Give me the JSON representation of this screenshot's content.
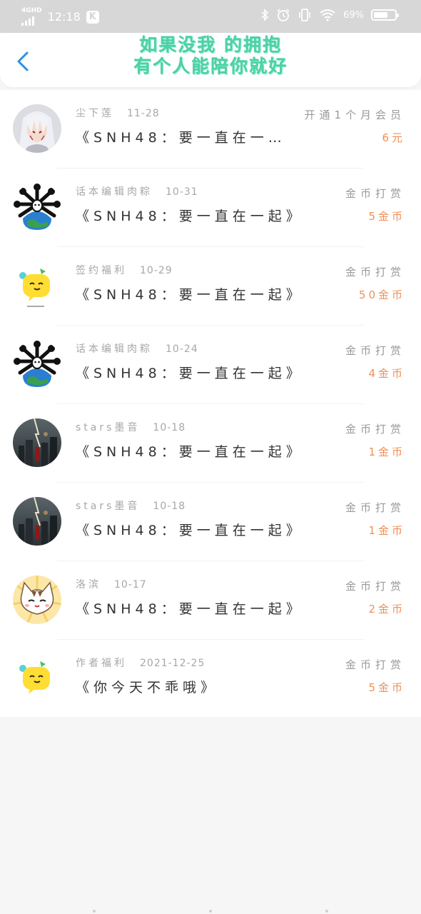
{
  "status_bar": {
    "network": "4GHD",
    "time": "12:18",
    "app_badge": "K",
    "battery": "69%",
    "battery_level": 0.69
  },
  "header": {
    "title_line1": "如果没我 的拥抱",
    "title_line2": "有个人能陪你就好"
  },
  "records": [
    {
      "name": "尘下莲",
      "date": "11-28",
      "book": "《SNH48：要一直在一…",
      "type": "开通1个月会员",
      "amount": "6元",
      "avatar": "silver-hair-anime-avatar"
    },
    {
      "name": "话本编辑肉粽",
      "date": "10-31",
      "book": "《SNH48：要一直在一起》",
      "type": "金币打赏",
      "amount": "5金币",
      "avatar": "earth-spider-avatar"
    },
    {
      "name": "签约福利",
      "date": "10-29",
      "book": "《SNH48：要一直在一起》",
      "type": "金币打赏",
      "amount": "50金币",
      "avatar": "yellow-chat-bubble-avatar"
    },
    {
      "name": "话本编辑肉粽",
      "date": "10-24",
      "book": "《SNH48：要一直在一起》",
      "type": "金币打赏",
      "amount": "4金币",
      "avatar": "earth-spider-avatar"
    },
    {
      "name": "stars墨音",
      "date": "10-18",
      "book": "《SNH48：要一直在一起》",
      "type": "金币打赏",
      "amount": "1金币",
      "avatar": "stormy-city-avatar"
    },
    {
      "name": "stars墨音",
      "date": "10-18",
      "book": "《SNH48：要一直在一起》",
      "type": "金币打赏",
      "amount": "1金币",
      "avatar": "stormy-city-avatar"
    },
    {
      "name": "洛滨",
      "date": "10-17",
      "book": "《SNH48：要一直在一起》",
      "type": "金币打赏",
      "amount": "2金币",
      "avatar": "cartoon-cat-avatar"
    },
    {
      "name": "作者福利",
      "date": "2021-12-25",
      "book": "《你今天不乖哦》",
      "type": "金币打赏",
      "amount": "5金币",
      "avatar": "yellow-chat-bubble-avatar"
    }
  ]
}
